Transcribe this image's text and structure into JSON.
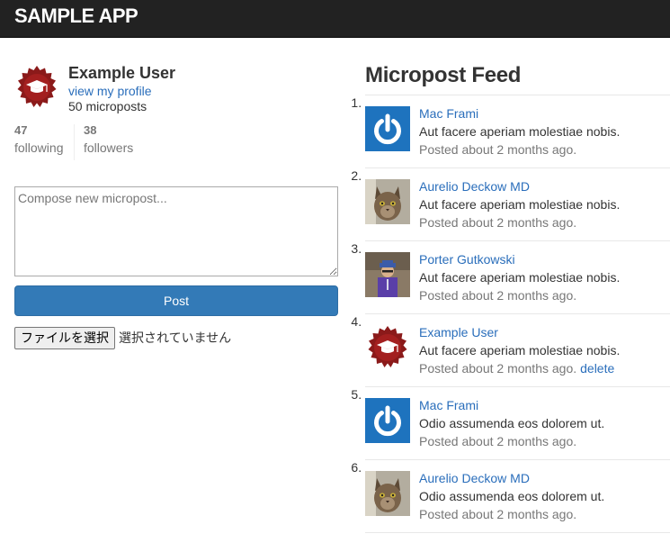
{
  "app": {
    "brand": "SAMPLE APP"
  },
  "user": {
    "name": "Example User",
    "profile_link": "view my profile",
    "microposts": "50 microposts",
    "following_count": "47",
    "following_label": "following",
    "followers_count": "38",
    "followers_label": "followers"
  },
  "compose": {
    "placeholder": "Compose new micropost...",
    "post_label": "Post",
    "file_button": "ファイルを選択",
    "file_status": "選択されていません"
  },
  "feed": {
    "title": "Micropost Feed",
    "delete_label": "delete",
    "items": [
      {
        "author": "Mac Frami",
        "content": "Aut facere aperiam molestiae nobis.",
        "timestamp": "Posted about 2 months ago.",
        "avatar": "power-icon"
      },
      {
        "author": "Aurelio Deckow MD",
        "content": "Aut facere aperiam molestiae nobis.",
        "timestamp": "Posted about 2 months ago.",
        "avatar": "cat-photo"
      },
      {
        "author": "Porter Gutkowski",
        "content": "Aut facere aperiam molestiae nobis.",
        "timestamp": "Posted about 2 months ago.",
        "avatar": "person-photo"
      },
      {
        "author": "Example User",
        "content": "Aut facere aperiam molestiae nobis.",
        "timestamp": "Posted about 2 months ago.",
        "avatar": "graduation-seal-icon"
      },
      {
        "author": "Mac Frami",
        "content": "Odio assumenda eos dolorem ut.",
        "timestamp": "Posted about 2 months ago.",
        "avatar": "power-icon"
      },
      {
        "author": "Aurelio Deckow MD",
        "content": "Odio assumenda eos dolorem ut.",
        "timestamp": "Posted about 2 months ago.",
        "avatar": "cat-photo"
      }
    ]
  },
  "colors": {
    "navbar": "#222222",
    "link": "#2a6ebb",
    "button": "#337ab7",
    "seal": "#8b1a1a",
    "power": "#1e73be"
  }
}
